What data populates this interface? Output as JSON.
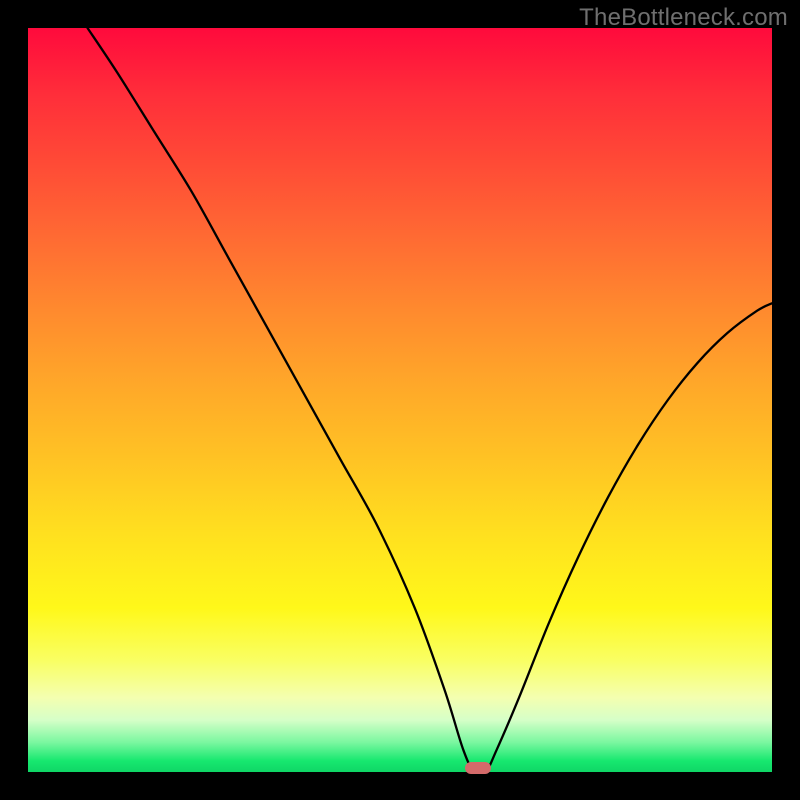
{
  "watermark": "TheBottleneck.com",
  "chart_data": {
    "type": "line",
    "title": "",
    "xlabel": "",
    "ylabel": "",
    "xlim": [
      0,
      100
    ],
    "ylim": [
      0,
      100
    ],
    "background_gradient": {
      "description": "vertical gradient from red at top through orange and yellow to green at bottom",
      "stops": [
        {
          "pos": 0,
          "color": "#ff0a3c"
        },
        {
          "pos": 50,
          "color": "#ffb026"
        },
        {
          "pos": 80,
          "color": "#fffb30"
        },
        {
          "pos": 100,
          "color": "#0fd666"
        }
      ]
    },
    "series": [
      {
        "name": "bottleneck-curve",
        "x": [
          8,
          12,
          17,
          22,
          27,
          32,
          37,
          42,
          47,
          52,
          56,
          58.5,
          60,
          61.5,
          63,
          66,
          70,
          74,
          78,
          82,
          86,
          90,
          94,
          98,
          100
        ],
        "y": [
          100,
          94,
          86,
          78,
          69,
          60,
          51,
          42,
          33,
          22,
          11,
          3,
          0,
          0,
          3,
          10,
          20,
          29,
          37,
          44,
          50,
          55,
          59,
          62,
          63
        ]
      }
    ],
    "marker": {
      "name": "optimal-point",
      "x": 60.5,
      "y": 0,
      "color": "#d46a6a",
      "shape": "pill"
    }
  }
}
